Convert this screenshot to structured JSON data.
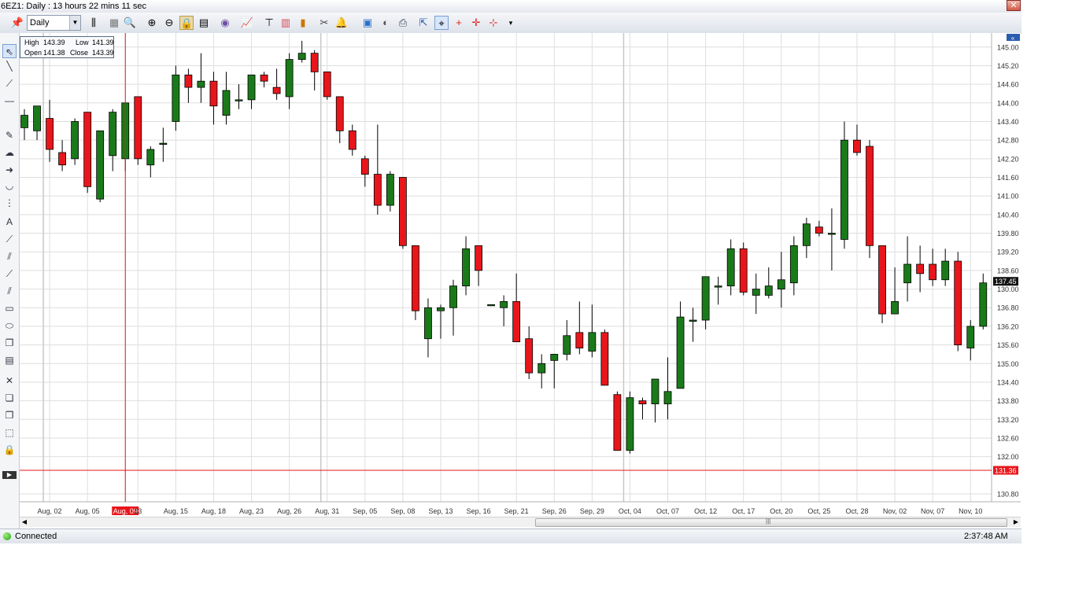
{
  "window": {
    "title": "6EZ1: Daily : 13 hours 22 mins 11 sec",
    "close_glyph": "✕"
  },
  "toolbar": {
    "timeframe": "Daily",
    "icons": [
      "pin-icon",
      "timeframe-select",
      "bar-type-icon",
      "blank-chart-icon",
      "zoom-menu-icon",
      "zoom-in-icon",
      "zoom-out-icon",
      "lock-scale-icon",
      "chart-properties-icon",
      "data-series-icon",
      "indicators-icon",
      "strategies-icon",
      "bar-sizes-icon",
      "performance-icon",
      "cut-icon",
      "alert-bell-icon",
      "book-icon",
      "chart-trader-icon",
      "print-icon",
      "pointer-icon",
      "cursor-crosshair-icon",
      "crosshair-icon",
      "global-crosshair-icon",
      "horizontal-crosshair-icon",
      "more-arrow-icon"
    ]
  },
  "left_tools": [
    "pointer-tool-icon",
    "line-tool-icon",
    "ray-tool-icon",
    "horizontal-line-tool-icon",
    "text-tool-icon",
    "note-tool-icon",
    "arrow-tool-icon",
    "arc-tool-icon",
    "fibonacci-tool-icon",
    "andrews-pitchfork-icon",
    "gann-fan-icon",
    "regression-channel-icon",
    "trend-channel-icon",
    "parallel-lines-icon",
    "rectangle-tool-icon",
    "ellipse-tool-icon",
    "copy-tool-icon",
    "template-tool-icon",
    "delete-tool-icon",
    "layers-tool-icon",
    "duplicate-tool-icon",
    "select-region-icon",
    "lock-tool-icon",
    "expand-panel-icon"
  ],
  "ohlc": {
    "high_label": "High",
    "high": "143.39",
    "low_label": "Low",
    "low": "141.39",
    "open_label": "Open",
    "open": "141.38",
    "close_label": "Close",
    "close": "143.39"
  },
  "status": {
    "connection": "Connected",
    "time": "2:37:48 AM"
  },
  "chart_data": {
    "type": "candlestick",
    "ylim": [
      130.6,
      145.4
    ],
    "ytick_labels": [
      "145.00",
      "145.20",
      "144.60",
      "144.00",
      "143.40",
      "142.80",
      "142.20",
      "141.60",
      "141.00",
      "140.40",
      "139.80",
      "139.20",
      "138.60",
      "130.00",
      "137.45",
      "136.80",
      "136.20",
      "135.60",
      "135.00",
      "134.40",
      "133.80",
      "133.20",
      "132.60",
      "132.00",
      "131.36",
      "130.80"
    ],
    "ytick_values": [
      145.0,
      144.4,
      143.8,
      143.2,
      142.6,
      142.0,
      141.4,
      140.8,
      140.2,
      139.6,
      139.0,
      138.4,
      137.8,
      137.2,
      137.45,
      136.6,
      136.0,
      135.4,
      134.8,
      134.2,
      133.6,
      133.0,
      132.4,
      131.8,
      131.36,
      130.6
    ],
    "xtick_labels": [
      "Aug, 02",
      "Aug, 05",
      "Aug, 09",
      "13",
      "Aug, 15",
      "Aug, 18",
      "Aug, 23",
      "Aug, 26",
      "Aug, 31",
      "Sep, 05",
      "Sep, 08",
      "Sep, 13",
      "Sep, 16",
      "Sep, 21",
      "Sep, 26",
      "Sep, 29",
      "Oct, 04",
      "Oct, 07",
      "Oct, 12",
      "Oct, 17",
      "Oct, 20",
      "Oct, 25",
      "Oct, 28",
      "Nov, 02",
      "Nov, 07",
      "Nov, 10"
    ],
    "xtick_index": [
      2,
      5,
      8,
      9,
      12,
      15,
      18,
      21,
      24,
      27,
      30,
      33,
      36,
      39,
      42,
      45,
      48,
      51,
      54,
      57,
      60,
      63,
      66,
      69,
      72,
      75
    ],
    "current_price": "137.45",
    "crosshair_price": "131.36",
    "crosshair_index": 8,
    "up_color": "#1a7a1a",
    "down_color": "#e8161b",
    "grid": true,
    "candles": [
      {
        "o": 142.4,
        "h": 143.0,
        "l": 142.0,
        "c": 142.8
      },
      {
        "o": 142.3,
        "h": 143.1,
        "l": 142.0,
        "c": 143.1
      },
      {
        "o": 142.7,
        "h": 143.3,
        "l": 141.3,
        "c": 141.7
      },
      {
        "o": 141.6,
        "h": 142.0,
        "l": 141.0,
        "c": 141.2
      },
      {
        "o": 141.4,
        "h": 142.7,
        "l": 141.2,
        "c": 142.6
      },
      {
        "o": 142.9,
        "h": 142.9,
        "l": 140.3,
        "c": 140.5
      },
      {
        "o": 140.1,
        "h": 142.3,
        "l": 140.0,
        "c": 142.3
      },
      {
        "o": 141.5,
        "h": 143.0,
        "l": 141.0,
        "c": 142.9
      },
      {
        "o": 141.4,
        "h": 143.2,
        "l": 141.0,
        "c": 143.2
      },
      {
        "o": 143.4,
        "h": 143.4,
        "l": 141.2,
        "c": 141.4
      },
      {
        "o": 141.2,
        "h": 141.8,
        "l": 140.8,
        "c": 141.7
      },
      {
        "o": 141.9,
        "h": 142.4,
        "l": 141.3,
        "c": 141.9
      },
      {
        "o": 142.6,
        "h": 144.4,
        "l": 142.3,
        "c": 144.1
      },
      {
        "o": 144.1,
        "h": 144.3,
        "l": 143.2,
        "c": 143.7
      },
      {
        "o": 143.7,
        "h": 144.8,
        "l": 143.2,
        "c": 143.9
      },
      {
        "o": 143.9,
        "h": 144.2,
        "l": 142.5,
        "c": 143.1
      },
      {
        "o": 142.8,
        "h": 144.2,
        "l": 142.5,
        "c": 143.6
      },
      {
        "o": 143.3,
        "h": 143.8,
        "l": 143.0,
        "c": 143.3
      },
      {
        "o": 143.3,
        "h": 144.1,
        "l": 143.0,
        "c": 144.1
      },
      {
        "o": 144.1,
        "h": 144.2,
        "l": 143.7,
        "c": 143.9
      },
      {
        "o": 143.7,
        "h": 144.3,
        "l": 143.3,
        "c": 143.5
      },
      {
        "o": 143.4,
        "h": 144.8,
        "l": 143.0,
        "c": 144.6
      },
      {
        "o": 144.6,
        "h": 145.2,
        "l": 144.5,
        "c": 144.8
      },
      {
        "o": 144.8,
        "h": 144.9,
        "l": 143.6,
        "c": 144.2
      },
      {
        "o": 144.2,
        "h": 144.2,
        "l": 143.3,
        "c": 143.4
      },
      {
        "o": 143.4,
        "h": 143.4,
        "l": 141.9,
        "c": 142.3
      },
      {
        "o": 142.3,
        "h": 142.5,
        "l": 141.5,
        "c": 141.7
      },
      {
        "o": 141.4,
        "h": 141.5,
        "l": 140.5,
        "c": 140.9
      },
      {
        "o": 140.9,
        "h": 142.5,
        "l": 139.6,
        "c": 139.9
      },
      {
        "o": 139.9,
        "h": 141.0,
        "l": 139.7,
        "c": 140.9
      },
      {
        "o": 140.8,
        "h": 140.8,
        "l": 138.5,
        "c": 138.6
      },
      {
        "o": 138.6,
        "h": 138.6,
        "l": 136.2,
        "c": 136.5
      },
      {
        "o": 135.6,
        "h": 136.9,
        "l": 135.0,
        "c": 136.6
      },
      {
        "o": 136.5,
        "h": 136.7,
        "l": 135.6,
        "c": 136.6
      },
      {
        "o": 136.6,
        "h": 137.5,
        "l": 135.7,
        "c": 137.3
      },
      {
        "o": 137.3,
        "h": 138.9,
        "l": 137.0,
        "c": 138.5
      },
      {
        "o": 138.6,
        "h": 138.6,
        "l": 137.3,
        "c": 137.8
      },
      {
        "o": 136.7,
        "h": 136.7,
        "l": 136.7,
        "c": 136.7
      },
      {
        "o": 136.6,
        "h": 137.0,
        "l": 136.0,
        "c": 136.8
      },
      {
        "o": 136.8,
        "h": 137.7,
        "l": 135.6,
        "c": 135.5
      },
      {
        "o": 135.6,
        "h": 136.0,
        "l": 134.3,
        "c": 134.5
      },
      {
        "o": 134.5,
        "h": 135.1,
        "l": 134.0,
        "c": 134.8
      },
      {
        "o": 134.9,
        "h": 135.0,
        "l": 134.0,
        "c": 135.1
      },
      {
        "o": 135.1,
        "h": 136.2,
        "l": 134.9,
        "c": 135.7
      },
      {
        "o": 135.8,
        "h": 136.8,
        "l": 135.1,
        "c": 135.3
      },
      {
        "o": 135.2,
        "h": 136.7,
        "l": 135.0,
        "c": 135.8
      },
      {
        "o": 135.8,
        "h": 135.9,
        "l": 134.1,
        "c": 134.1
      },
      {
        "o": 133.8,
        "h": 133.9,
        "l": 132.1,
        "c": 132.0
      },
      {
        "o": 132.0,
        "h": 133.9,
        "l": 131.9,
        "c": 133.7
      },
      {
        "o": 133.6,
        "h": 133.7,
        "l": 133.0,
        "c": 133.5
      },
      {
        "o": 133.5,
        "h": 134.1,
        "l": 132.9,
        "c": 134.3
      },
      {
        "o": 133.5,
        "h": 135.0,
        "l": 133.0,
        "c": 133.9
      },
      {
        "o": 134.0,
        "h": 136.8,
        "l": 134.0,
        "c": 136.3
      },
      {
        "o": 136.2,
        "h": 136.6,
        "l": 135.5,
        "c": 136.2
      },
      {
        "o": 136.2,
        "h": 137.6,
        "l": 135.9,
        "c": 137.6
      },
      {
        "o": 137.3,
        "h": 137.6,
        "l": 136.7,
        "c": 137.3
      },
      {
        "o": 137.3,
        "h": 138.8,
        "l": 137.0,
        "c": 138.5
      },
      {
        "o": 138.5,
        "h": 138.7,
        "l": 137.0,
        "c": 137.1
      },
      {
        "o": 137.0,
        "h": 137.7,
        "l": 136.4,
        "c": 137.2
      },
      {
        "o": 137.0,
        "h": 137.9,
        "l": 136.9,
        "c": 137.3
      },
      {
        "o": 137.2,
        "h": 138.4,
        "l": 136.6,
        "c": 137.5
      },
      {
        "o": 137.4,
        "h": 138.9,
        "l": 137.0,
        "c": 138.6
      },
      {
        "o": 138.6,
        "h": 139.5,
        "l": 138.2,
        "c": 139.3
      },
      {
        "o": 139.2,
        "h": 139.4,
        "l": 138.9,
        "c": 139.0
      },
      {
        "o": 139.0,
        "h": 139.8,
        "l": 137.8,
        "c": 139.0
      },
      {
        "o": 138.8,
        "h": 142.6,
        "l": 138.5,
        "c": 142.0
      },
      {
        "o": 142.0,
        "h": 142.5,
        "l": 141.5,
        "c": 141.6
      },
      {
        "o": 141.8,
        "h": 142.0,
        "l": 138.2,
        "c": 138.6
      },
      {
        "o": 138.6,
        "h": 138.6,
        "l": 136.1,
        "c": 136.4
      },
      {
        "o": 136.4,
        "h": 137.9,
        "l": 136.4,
        "c": 136.8
      },
      {
        "o": 137.4,
        "h": 138.9,
        "l": 136.8,
        "c": 138.0
      },
      {
        "o": 138.0,
        "h": 138.6,
        "l": 137.1,
        "c": 137.7
      },
      {
        "o": 138.0,
        "h": 138.5,
        "l": 137.3,
        "c": 137.5
      },
      {
        "o": 137.5,
        "h": 138.5,
        "l": 137.3,
        "c": 138.1
      },
      {
        "o": 138.1,
        "h": 138.4,
        "l": 135.2,
        "c": 135.4
      },
      {
        "o": 135.3,
        "h": 136.2,
        "l": 134.9,
        "c": 136.0
      },
      {
        "o": 136.0,
        "h": 137.7,
        "l": 135.9,
        "c": 137.4
      }
    ]
  }
}
